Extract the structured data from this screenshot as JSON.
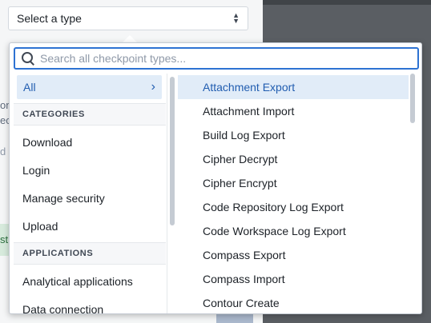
{
  "type_select": {
    "placeholder": "Select a type"
  },
  "background": {
    "left_peek_1": "on",
    "left_peek_2": "ec",
    "left_peek_3": "d i",
    "left_peek_4": "st"
  },
  "search": {
    "placeholder": "Search all checkpoint types..."
  },
  "left_panel": {
    "all_label": "All",
    "categories_header": "CATEGORIES",
    "categories": [
      "Download",
      "Login",
      "Manage security",
      "Upload"
    ],
    "applications_header": "APPLICATIONS",
    "applications": [
      "Analytical applications",
      "Data connection"
    ]
  },
  "right_panel": {
    "selected_index": 0,
    "items": [
      "Attachment Export",
      "Attachment Import",
      "Build Log Export",
      "Cipher Decrypt",
      "Cipher Encrypt",
      "Code Repository Log Export",
      "Code Workspace Log Export",
      "Compass Export",
      "Compass Import",
      "Contour Create"
    ]
  },
  "colors": {
    "accent": "#2d72d2",
    "selected_bg": "#e1ecf8",
    "selected_text": "#215db0"
  }
}
